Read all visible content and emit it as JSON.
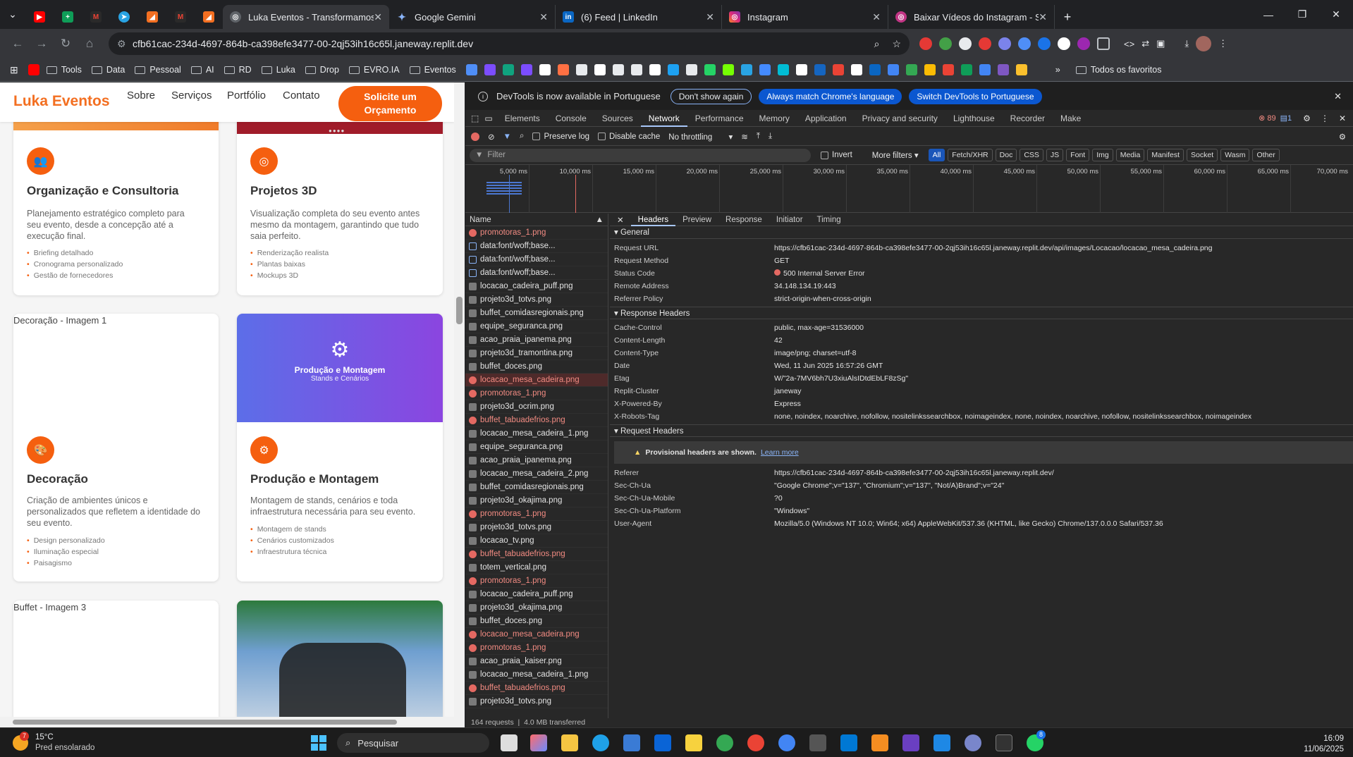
{
  "tabs": [
    {
      "title": "Luka Eventos - Transformamos",
      "active": true
    },
    {
      "title": "Google Gemini"
    },
    {
      "title": "(6) Feed | LinkedIn"
    },
    {
      "title": "Instagram"
    },
    {
      "title": "Baixar Vídeos do Instagram - Sn"
    }
  ],
  "omnibox": {
    "url": "cfb61cac-234d-4697-864b-ca398efe3477-00-2qj53ih16c65l.janeway.replit.dev"
  },
  "bookmarks": {
    "items": [
      "Tools",
      "Data",
      "Pessoal",
      "AI",
      "RD",
      "Luka",
      "Drop",
      "EVRO.IA",
      "Eventos"
    ],
    "all": "Todos os favoritos"
  },
  "site": {
    "logo": "Luka Eventos",
    "nav": [
      "Sobre",
      "Serviços",
      "Portfólio",
      "Contato"
    ],
    "cta_line1": "Solicite um",
    "cta_line2": "Orçamento",
    "cards": [
      {
        "title": "Organização e Consultoria",
        "desc1": "Planejamento estratégico completo para",
        "desc2": "seu evento, desde a concepção até a",
        "desc3": "execução final.",
        "items": [
          "Briefing detalhado",
          "Cronograma personalizado",
          "Gestão de fornecedores"
        ]
      },
      {
        "title": "Projetos 3D",
        "desc1": "Visualização completa do seu evento antes",
        "desc2": "mesmo da montagem, garantindo que tudo",
        "desc3": "saia perfeito.",
        "items": [
          "Renderização realista",
          "Plantas baixas",
          "Mockups 3D"
        ]
      },
      {
        "alt": "Decoração - Imagem 1",
        "title": "Decoração",
        "desc1": "Criação de ambientes únicos e",
        "desc2": "personalizados que refletem a identidade do",
        "desc3": "seu evento.",
        "items": [
          "Design personalizado",
          "Iluminação especial",
          "Paisagismo"
        ]
      },
      {
        "banner_title": "Produção e Montagem",
        "banner_sub": "Stands e Cenários",
        "title": "Produção e Montagem",
        "desc1": "Montagem de stands, cenários e toda",
        "desc2": "infraestrutura necessária para seu evento.",
        "items": [
          "Montagem de stands",
          "Cenários customizados",
          "Infraestrutura técnica"
        ]
      },
      {
        "alt": "Buffet - Imagem 3"
      }
    ]
  },
  "devtools": {
    "info": "DevTools is now available in Portuguese",
    "btn1": "Don't show again",
    "btn2": "Always match Chrome's language",
    "btn3": "Switch DevTools to Portuguese",
    "tabs": [
      "Elements",
      "Console",
      "Sources",
      "Network",
      "Performance",
      "Memory",
      "Application",
      "Privacy and security",
      "Lighthouse",
      "Recorder",
      "Make"
    ],
    "errors": "89",
    "msgs": "1",
    "preserve_log": "Preserve log",
    "disable_cache": "Disable cache",
    "throttle": "No throttling",
    "filter_placeholder": "Filter",
    "invert": "Invert",
    "more_filters": "More filters",
    "chips": [
      "All",
      "Fetch/XHR",
      "Doc",
      "CSS",
      "JS",
      "Font",
      "Img",
      "Media",
      "Manifest",
      "Socket",
      "Wasm",
      "Other"
    ],
    "ticks": [
      "5,000 ms",
      "10,000 ms",
      "15,000 ms",
      "20,000 ms",
      "25,000 ms",
      "30,000 ms",
      "35,000 ms",
      "40,000 ms",
      "45,000 ms",
      "50,000 ms",
      "55,000 ms",
      "60,000 ms",
      "65,000 ms",
      "70,000 ms"
    ],
    "name_header": "Name",
    "requests": [
      {
        "n": "promotoras_1.png",
        "t": "err"
      },
      {
        "n": "data:font/woff;base...",
        "t": "font"
      },
      {
        "n": "data:font/woff;base...",
        "t": "font"
      },
      {
        "n": "data:font/woff;base...",
        "t": "font"
      },
      {
        "n": "locacao_cadeira_puff.png",
        "t": "img"
      },
      {
        "n": "projeto3d_totvs.png",
        "t": "img"
      },
      {
        "n": "buffet_comidasregionais.png",
        "t": "img"
      },
      {
        "n": "equipe_seguranca.png",
        "t": "img"
      },
      {
        "n": "acao_praia_ipanema.png",
        "t": "img"
      },
      {
        "n": "projeto3d_tramontina.png",
        "t": "img"
      },
      {
        "n": "buffet_doces.png",
        "t": "img"
      },
      {
        "n": "locacao_mesa_cadeira.png",
        "t": "sel"
      },
      {
        "n": "promotoras_1.png",
        "t": "err"
      },
      {
        "n": "projeto3d_ocrim.png",
        "t": "img"
      },
      {
        "n": "buffet_tabuadefrios.png",
        "t": "err"
      },
      {
        "n": "locacao_mesa_cadeira_1.png",
        "t": "img"
      },
      {
        "n": "equipe_seguranca.png",
        "t": "img"
      },
      {
        "n": "acao_praia_ipanema.png",
        "t": "img"
      },
      {
        "n": "locacao_mesa_cadeira_2.png",
        "t": "img"
      },
      {
        "n": "buffet_comidasregionais.png",
        "t": "img"
      },
      {
        "n": "projeto3d_okajima.png",
        "t": "img"
      },
      {
        "n": "promotoras_1.png",
        "t": "err"
      },
      {
        "n": "projeto3d_totvs.png",
        "t": "img"
      },
      {
        "n": "locacao_tv.png",
        "t": "img"
      },
      {
        "n": "buffet_tabuadefrios.png",
        "t": "err"
      },
      {
        "n": "totem_vertical.png",
        "t": "img"
      },
      {
        "n": "promotoras_1.png",
        "t": "err"
      },
      {
        "n": "locacao_cadeira_puff.png",
        "t": "img"
      },
      {
        "n": "projeto3d_okajima.png",
        "t": "img"
      },
      {
        "n": "buffet_doces.png",
        "t": "img"
      },
      {
        "n": "locacao_mesa_cadeira.png",
        "t": "err"
      },
      {
        "n": "promotoras_1.png",
        "t": "err"
      },
      {
        "n": "acao_praia_kaiser.png",
        "t": "img"
      },
      {
        "n": "locacao_mesa_cadeira_1.png",
        "t": "img"
      },
      {
        "n": "buffet_tabuadefrios.png",
        "t": "err"
      },
      {
        "n": "projeto3d_totvs.png",
        "t": "img"
      }
    ],
    "status_requests": "164 requests",
    "status_transferred": "4.0 MB transferred",
    "detail_tabs": [
      "Headers",
      "Preview",
      "Response",
      "Initiator",
      "Timing"
    ],
    "general_title": "General",
    "general": [
      {
        "k": "Request URL",
        "v": "https://cfb61cac-234d-4697-864b-ca398efe3477-00-2qj53ih16c65l.janeway.replit.dev/api/images/Locacao/locacao_mesa_cadeira.png"
      },
      {
        "k": "Request Method",
        "v": "GET"
      },
      {
        "k": "Status Code",
        "v": "500 Internal Server Error"
      },
      {
        "k": "Remote Address",
        "v": "34.148.134.19:443"
      },
      {
        "k": "Referrer Policy",
        "v": "strict-origin-when-cross-origin"
      }
    ],
    "response_title": "Response Headers",
    "response": [
      {
        "k": "Cache-Control",
        "v": "public, max-age=31536000"
      },
      {
        "k": "Content-Length",
        "v": "42"
      },
      {
        "k": "Content-Type",
        "v": "image/png; charset=utf-8"
      },
      {
        "k": "Date",
        "v": "Wed, 11 Jun 2025 16:57:26 GMT"
      },
      {
        "k": "Etag",
        "v": "W/\"2a-7MV6bh7U3xiuAlsIDtdEbLF8zSg\""
      },
      {
        "k": "Replit-Cluster",
        "v": "janeway"
      },
      {
        "k": "X-Powered-By",
        "v": "Express"
      },
      {
        "k": "X-Robots-Tag",
        "v": "none, noindex, noarchive, nofollow, nositelinkssearchbox, noimageindex, none, noindex, noarchive, nofollow, nositelinkssearchbox, noimageindex"
      }
    ],
    "request_title": "Request Headers",
    "provisional": "Provisional headers are shown.",
    "learn_more": "Learn more",
    "request": [
      {
        "k": "Referer",
        "v": "https://cfb61cac-234d-4697-864b-ca398efe3477-00-2qj53ih16c65l.janeway.replit.dev/"
      },
      {
        "k": "Sec-Ch-Ua",
        "v": "\"Google Chrome\";v=\"137\", \"Chromium\";v=\"137\", \"Not/A)Brand\";v=\"24\""
      },
      {
        "k": "Sec-Ch-Ua-Mobile",
        "v": "?0"
      },
      {
        "k": "Sec-Ch-Ua-Platform",
        "v": "\"Windows\""
      },
      {
        "k": "User-Agent",
        "v": "Mozilla/5.0 (Windows NT 10.0; Win64; x64) AppleWebKit/537.36 (KHTML, like Gecko) Chrome/137.0.0.0 Safari/537.36"
      }
    ]
  },
  "taskbar": {
    "weather_temp": "15°C",
    "weather_desc": "Pred ensolarado",
    "weather_badge": "7",
    "search": "Pesquisar",
    "time": "16:09",
    "date": "11/06/2025",
    "whatsapp_badge": "8"
  }
}
